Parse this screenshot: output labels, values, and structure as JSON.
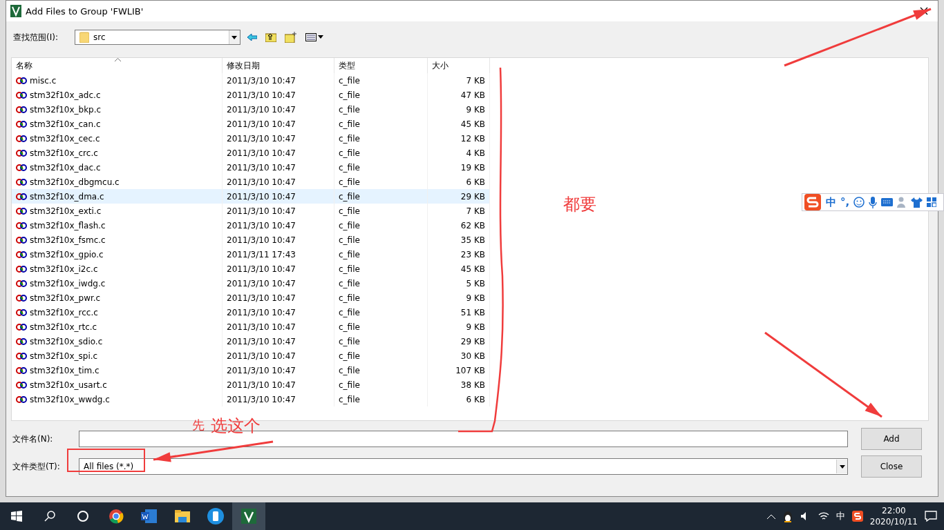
{
  "window": {
    "title": "Add Files to Group 'FWLIB'"
  },
  "look_in": {
    "label": "查找范围(I):",
    "value": "src"
  },
  "columns": [
    "名称",
    "修改日期",
    "类型",
    "大小"
  ],
  "files": [
    {
      "name": "misc.c",
      "date": "2011/3/10 10:47",
      "type": "c_file",
      "size": "7 KB",
      "highlighted": false
    },
    {
      "name": "stm32f10x_adc.c",
      "date": "2011/3/10 10:47",
      "type": "c_file",
      "size": "47 KB",
      "highlighted": false
    },
    {
      "name": "stm32f10x_bkp.c",
      "date": "2011/3/10 10:47",
      "type": "c_file",
      "size": "9 KB",
      "highlighted": false
    },
    {
      "name": "stm32f10x_can.c",
      "date": "2011/3/10 10:47",
      "type": "c_file",
      "size": "45 KB",
      "highlighted": false
    },
    {
      "name": "stm32f10x_cec.c",
      "date": "2011/3/10 10:47",
      "type": "c_file",
      "size": "12 KB",
      "highlighted": false
    },
    {
      "name": "stm32f10x_crc.c",
      "date": "2011/3/10 10:47",
      "type": "c_file",
      "size": "4 KB",
      "highlighted": false
    },
    {
      "name": "stm32f10x_dac.c",
      "date": "2011/3/10 10:47",
      "type": "c_file",
      "size": "19 KB",
      "highlighted": false
    },
    {
      "name": "stm32f10x_dbgmcu.c",
      "date": "2011/3/10 10:47",
      "type": "c_file",
      "size": "6 KB",
      "highlighted": false
    },
    {
      "name": "stm32f10x_dma.c",
      "date": "2011/3/10 10:47",
      "type": "c_file",
      "size": "29 KB",
      "highlighted": true
    },
    {
      "name": "stm32f10x_exti.c",
      "date": "2011/3/10 10:47",
      "type": "c_file",
      "size": "7 KB",
      "highlighted": false
    },
    {
      "name": "stm32f10x_flash.c",
      "date": "2011/3/10 10:47",
      "type": "c_file",
      "size": "62 KB",
      "highlighted": false
    },
    {
      "name": "stm32f10x_fsmc.c",
      "date": "2011/3/10 10:47",
      "type": "c_file",
      "size": "35 KB",
      "highlighted": false
    },
    {
      "name": "stm32f10x_gpio.c",
      "date": "2011/3/11 17:43",
      "type": "c_file",
      "size": "23 KB",
      "highlighted": false
    },
    {
      "name": "stm32f10x_i2c.c",
      "date": "2011/3/10 10:47",
      "type": "c_file",
      "size": "45 KB",
      "highlighted": false
    },
    {
      "name": "stm32f10x_iwdg.c",
      "date": "2011/3/10 10:47",
      "type": "c_file",
      "size": "5 KB",
      "highlighted": false
    },
    {
      "name": "stm32f10x_pwr.c",
      "date": "2011/3/10 10:47",
      "type": "c_file",
      "size": "9 KB",
      "highlighted": false
    },
    {
      "name": "stm32f10x_rcc.c",
      "date": "2011/3/10 10:47",
      "type": "c_file",
      "size": "51 KB",
      "highlighted": false
    },
    {
      "name": "stm32f10x_rtc.c",
      "date": "2011/3/10 10:47",
      "type": "c_file",
      "size": "9 KB",
      "highlighted": false
    },
    {
      "name": "stm32f10x_sdio.c",
      "date": "2011/3/10 10:47",
      "type": "c_file",
      "size": "29 KB",
      "highlighted": false
    },
    {
      "name": "stm32f10x_spi.c",
      "date": "2011/3/10 10:47",
      "type": "c_file",
      "size": "30 KB",
      "highlighted": false
    },
    {
      "name": "stm32f10x_tim.c",
      "date": "2011/3/10 10:47",
      "type": "c_file",
      "size": "107 KB",
      "highlighted": false
    },
    {
      "name": "stm32f10x_usart.c",
      "date": "2011/3/10 10:47",
      "type": "c_file",
      "size": "38 KB",
      "highlighted": false
    },
    {
      "name": "stm32f10x_wwdg.c",
      "date": "2011/3/10 10:47",
      "type": "c_file",
      "size": "6 KB",
      "highlighted": false
    }
  ],
  "file_name": {
    "label": "文件名(N):"
  },
  "file_type": {
    "label": "文件类型(T):",
    "value": "All files (*.*)"
  },
  "buttons": [
    "Add",
    "Close"
  ],
  "annotations": {
    "all_needed": "都要",
    "first": "先",
    "choose_this": "选这个"
  },
  "ime_bar": {
    "mode": "中",
    "punctuation": "°,"
  },
  "tray": {
    "ime": "中",
    "time": "22:00",
    "date": "2020/10/11"
  }
}
